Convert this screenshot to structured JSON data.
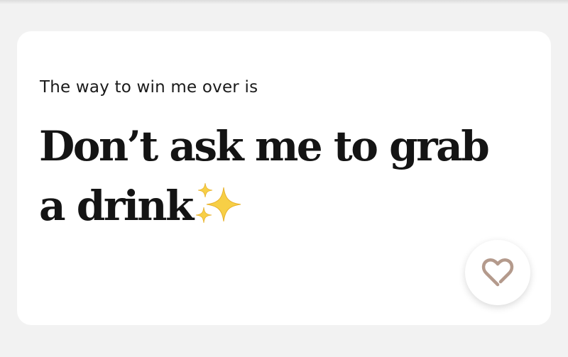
{
  "prompt": {
    "label": "The way to win me over is",
    "answer": "Don’t ask me to grab a drink",
    "emoji": "sparkles-icon"
  },
  "actions": {
    "like_icon": "heart-outline-icon",
    "like_icon_color": "#b49a8c"
  }
}
